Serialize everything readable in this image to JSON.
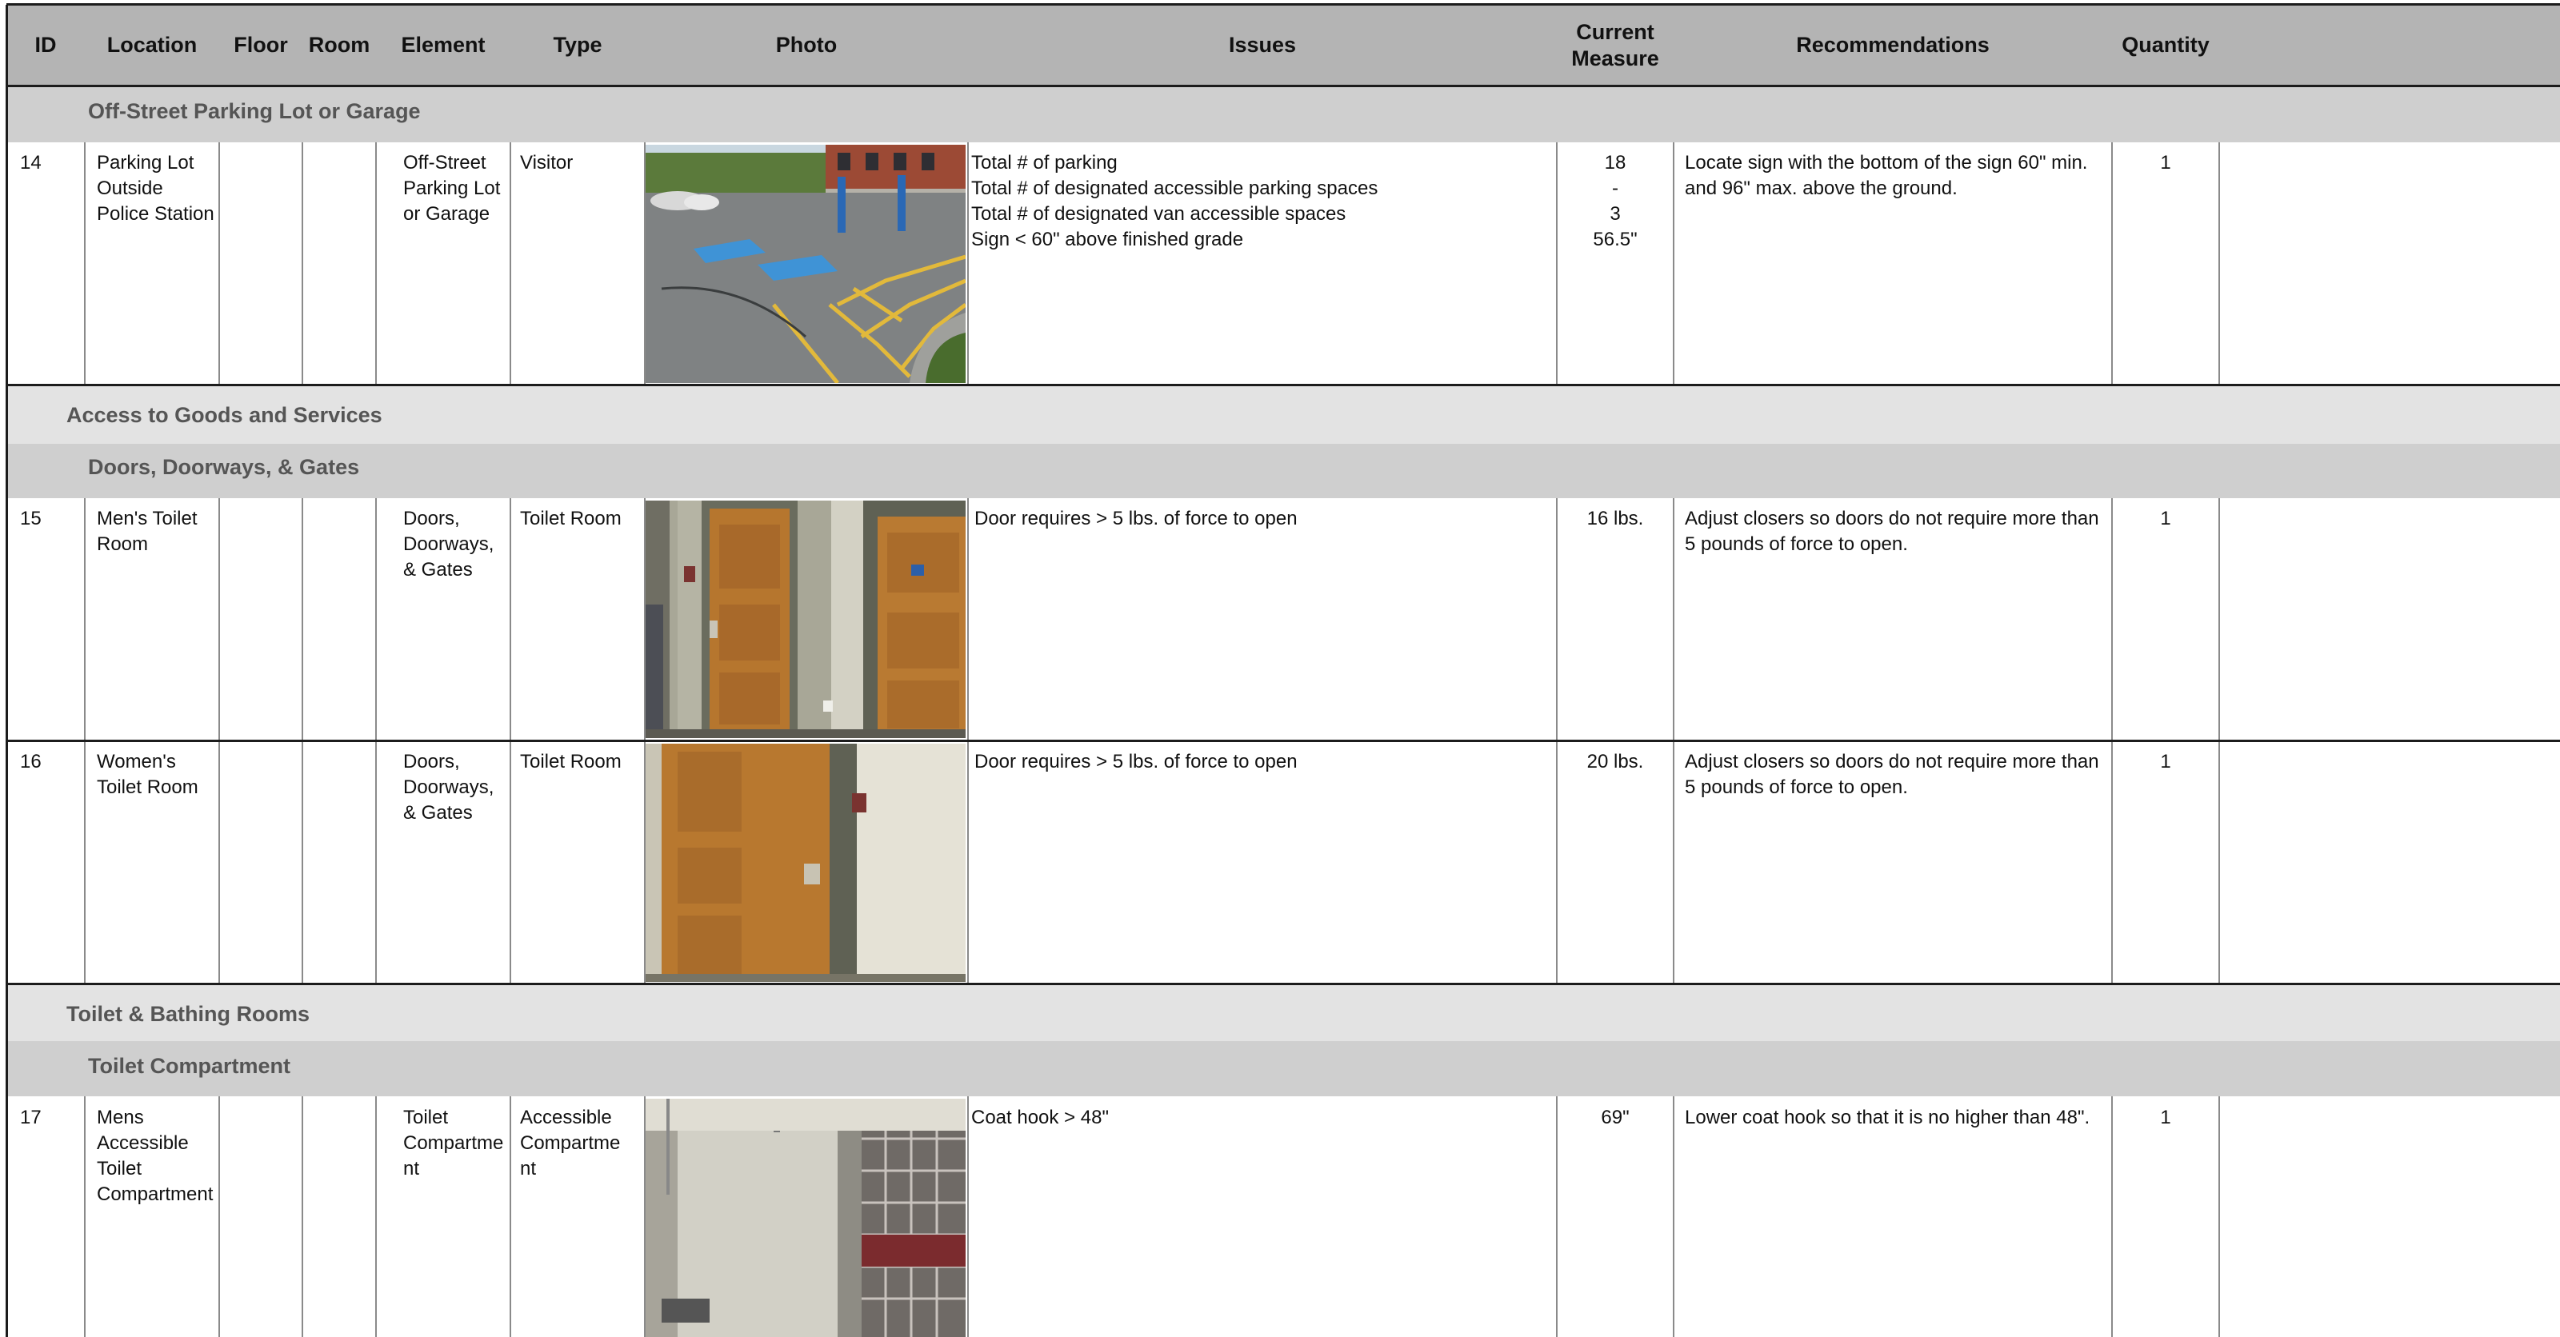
{
  "columns": {
    "id": "ID",
    "location": "Location",
    "floor": "Floor",
    "room": "Room",
    "element": "Element",
    "type": "Type",
    "photo": "Photo",
    "issues": "Issues",
    "current_measure": "Current Measure",
    "recommendations": "Recommendations",
    "quantity": "Quantity"
  },
  "sections": {
    "parking": "Off-Street Parking Lot or Garage",
    "access": "Access to Goods and Services",
    "doors": "Doors, Doorways, & Gates",
    "toilet": "Toilet & Bathing Rooms",
    "compartment": "Toilet Compartment"
  },
  "rows": [
    {
      "id": "14",
      "location": "Parking Lot Outside Police Station",
      "element": "Off-Street Parking Lot or Garage",
      "type": "Visitor",
      "photo_icon": "parking-lot-photo",
      "issues": [
        "Total # of parking",
        "Total # of designated accessible parking spaces",
        "Total # of designated van accessible spaces",
        "Sign < 60\" above finished grade"
      ],
      "measures": [
        "18",
        "-",
        "3",
        "56.5\""
      ],
      "recommendation": "Locate sign with the bottom of the sign 60\" min. and 96\" max. above the ground.",
      "quantity": "1"
    },
    {
      "id": "15",
      "location": "Men's Toilet Room",
      "element": "Doors, Doorways, & Gates",
      "type": "Toilet Room",
      "photo_icon": "double-door-photo",
      "issues": [
        "Door requires > 5 lbs. of force to open"
      ],
      "measures": [
        "16 lbs."
      ],
      "recommendation": "Adjust closers so doors do not require more than 5 pounds of force to open.",
      "quantity": "1"
    },
    {
      "id": "16",
      "location": "Women's Toilet Room",
      "element": "Doors, Doorways, & Gates",
      "type": "Toilet Room",
      "photo_icon": "single-door-photo",
      "issues": [
        "Door requires > 5 lbs. of force to open"
      ],
      "measures": [
        "20 lbs."
      ],
      "recommendation": "Adjust closers so doors do not require more than 5 pounds of force to open.",
      "quantity": "1"
    },
    {
      "id": "17",
      "location": "Mens Accessible Toilet Compartment",
      "element": "Toilet Compartme nt",
      "type": "Accessible Compartme nt",
      "photo_icon": "toilet-compartment-photo",
      "issues": [
        "Coat hook > 48\""
      ],
      "measures": [
        "69\""
      ],
      "recommendation": "Lower coat hook so that it is no higher than 48\".",
      "quantity": "1"
    }
  ],
  "colors": {
    "header_bg": "#b4b4b4",
    "section_dark": "#cfcfcf",
    "section_light": "#e3e3e3",
    "section_text": "#555555"
  }
}
